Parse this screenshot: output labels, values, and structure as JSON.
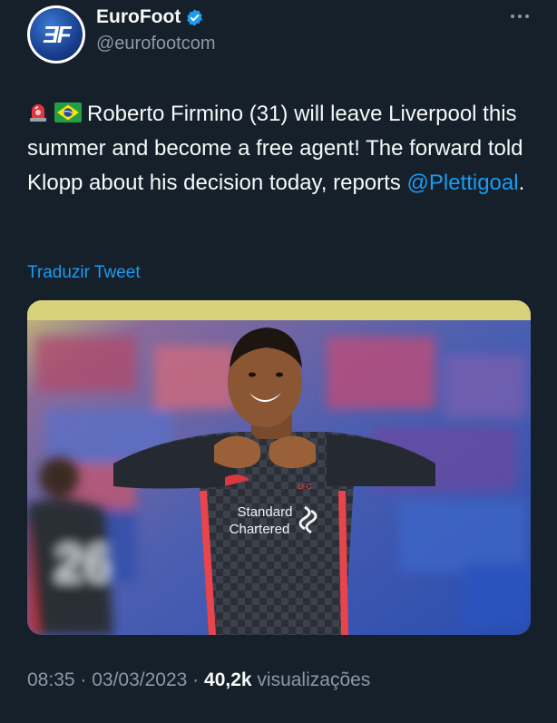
{
  "author": {
    "display_name": "EuroFoot",
    "handle": "@eurofootcom",
    "avatar_logo": "ƎF",
    "verified": true
  },
  "tweet": {
    "emojis": [
      "rotating-light-emoji",
      "brazil-flag-emoji"
    ],
    "text_before_mention": "Roberto Firmino (31) will leave Liverpool this summer and become a free agent! The forward told Klopp about his decision today, reports ",
    "mention": "@Plettigoal",
    "text_after_mention": ".",
    "translate_label": "Traduzir Tweet"
  },
  "media": {
    "shirt_sponsor_line1": "Standard",
    "shirt_sponsor_line2": "Chartered",
    "crest_text": "LFC",
    "background_shirt_number": "26"
  },
  "meta": {
    "time": "08:35",
    "separator": " · ",
    "date": "03/03/2023",
    "views_count": "40,2k",
    "views_label": " visualizações"
  },
  "colors": {
    "background": "#15202b",
    "text": "#f7f9f9",
    "secondary_text": "#8b98a5",
    "accent": "#1d9bf0"
  }
}
